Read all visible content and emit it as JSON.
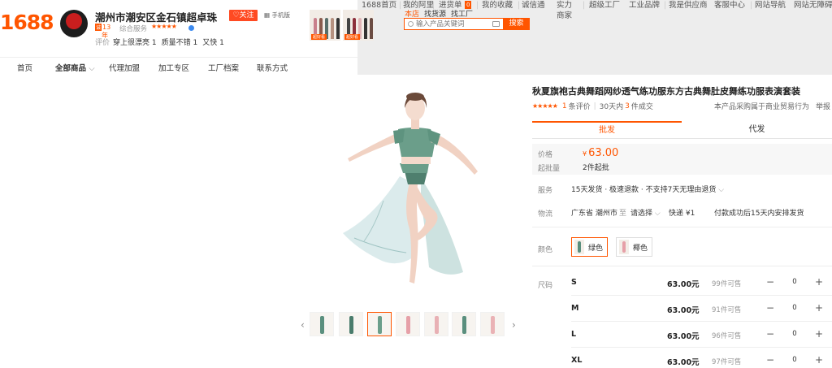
{
  "header": {
    "logo": "1688",
    "shop_name": "潮州市潮安区金石镇超卓珠",
    "follow": "关注",
    "mobile": "手机版",
    "year_num": "13",
    "year_unit": "年",
    "rating_label": "综合服务",
    "rating_stars": "★★★★★",
    "review_label": "评价",
    "reviews": [
      "穿上很漂亮 1",
      "质量不错 1",
      "又快 1"
    ],
    "thumb_tags": [
      "超好看",
      "超好看"
    ],
    "topnav": [
      "1688首页",
      "我的阿里",
      "进货单",
      "0",
      "我的收藏",
      "诚信通",
      "实力商家",
      "超级工厂",
      "工业品牌",
      "我是供应商",
      "客服中心",
      "网站导航",
      "网站无障碍"
    ],
    "search_tabs": [
      "本店",
      "找货源",
      "找工厂"
    ],
    "search_placeholder": "输入产品关键词",
    "search_button": "搜索"
  },
  "shop_nav": [
    "首页",
    "全部商品",
    "代理加盟",
    "加工专区",
    "工厂档案",
    "联系方式"
  ],
  "colors": {
    "accent": "#ff5500",
    "green_outfit": "#5a8f7e",
    "pink_outfit": "#e6a0a8"
  },
  "product": {
    "title": "秋夏旗袍古典舞蹈网纱透气练功服东方古典舞肚皮舞练功服表演套装",
    "stars": "★★★★★",
    "review_count": "1",
    "review_unit": "条评价",
    "sales_prefix": "30天内",
    "sales_count": "3",
    "sales_unit": "件成交",
    "trade_note": "本产品采购属于商业贸易行为",
    "report": "举报",
    "tab_wholesale": "批发",
    "tab_dropship": "代发",
    "price_label": "价格",
    "currency": "¥",
    "price": "63.00",
    "moq_label": "起批量",
    "moq": "2件起批",
    "service_label": "服务",
    "service": "15天发货 · 极速退款 · 不支持7天无理由退货",
    "logistics_label": "物流",
    "origin": "广东省 潮州市",
    "to": "至",
    "dest": "请选择",
    "express": "快递 ¥1",
    "ship_note": "付款成功后15天内安排发货",
    "color_label": "颜色",
    "color_options": [
      "绿色",
      "椰色"
    ],
    "size_label": "尺码",
    "sizes": [
      {
        "size": "S",
        "price": "63.00元",
        "stock": "99件可售",
        "qty": "0"
      },
      {
        "size": "M",
        "price": "63.00元",
        "stock": "91件可售",
        "qty": "0"
      },
      {
        "size": "L",
        "price": "63.00元",
        "stock": "96件可售",
        "qty": "0"
      },
      {
        "size": "XL",
        "price": "63.00元",
        "stock": "97件可售",
        "qty": "0"
      }
    ]
  }
}
